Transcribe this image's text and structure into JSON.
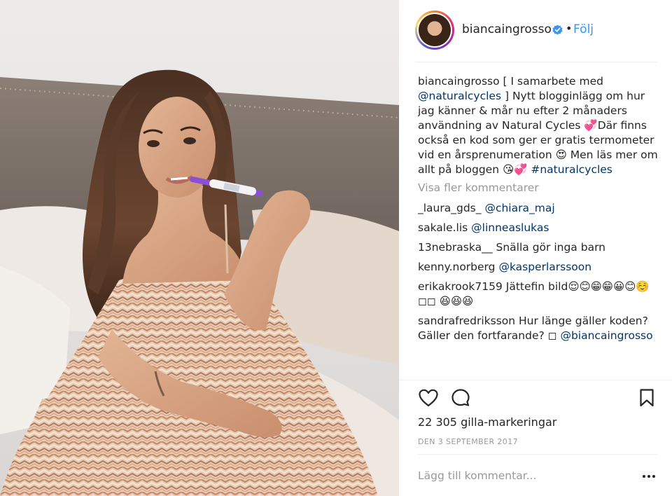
{
  "header": {
    "username": "biancaingrosso",
    "separator": "•",
    "follow_label": "Följ"
  },
  "caption": {
    "username": "biancaingrosso",
    "part1": "[ I samarbete med ",
    "mention": "@naturalcycles",
    "part2": " ] Nytt blogginlägg om hur jag känner & mår nu efter 2 månaders användning av Natural Cycles 💞Där finns också en kod som ger er gratis termometer vid en årsprenumeration 😍 Men läs mer om allt på bloggen 😘💞 ",
    "hashtag": "#naturalcycles"
  },
  "load_more": "Visa fler kommentarer",
  "comments": [
    {
      "user": "_laura_gds_",
      "text": "",
      "mention": "@chiara_maj"
    },
    {
      "user": "sakale.lis",
      "text": "",
      "mention": "@linneaslukas"
    },
    {
      "user": "13nebraska__",
      "text": "Snälla gör inga barn",
      "mention": ""
    },
    {
      "user": "kenny.norberg",
      "text": "",
      "mention": "@kasperlarssoon"
    },
    {
      "user": "erikakrook7159",
      "text": "Jättefin bild😌😊😁😁😀😊☺️◻◻ 😆😆😆",
      "mention": ""
    },
    {
      "user": "sandrafredriksson",
      "text": "Hur länge gäller koden? Gäller den fortfarande? ◻",
      "mention": "@biancaingrosso"
    }
  ],
  "likes": "22 305 gilla-markeringar",
  "date": "DEN 3 SEPTEMBER 2017",
  "add_comment_placeholder": "Lägg till kommentar...",
  "icons": {
    "like": "heart-icon",
    "comment": "comment-icon",
    "save": "bookmark-icon",
    "verified": "verified-badge-icon",
    "more": "more-options-icon"
  },
  "colors": {
    "link": "#3897f0",
    "mention": "#003569",
    "muted": "#999999",
    "text": "#262626",
    "divider": "#efefef"
  }
}
